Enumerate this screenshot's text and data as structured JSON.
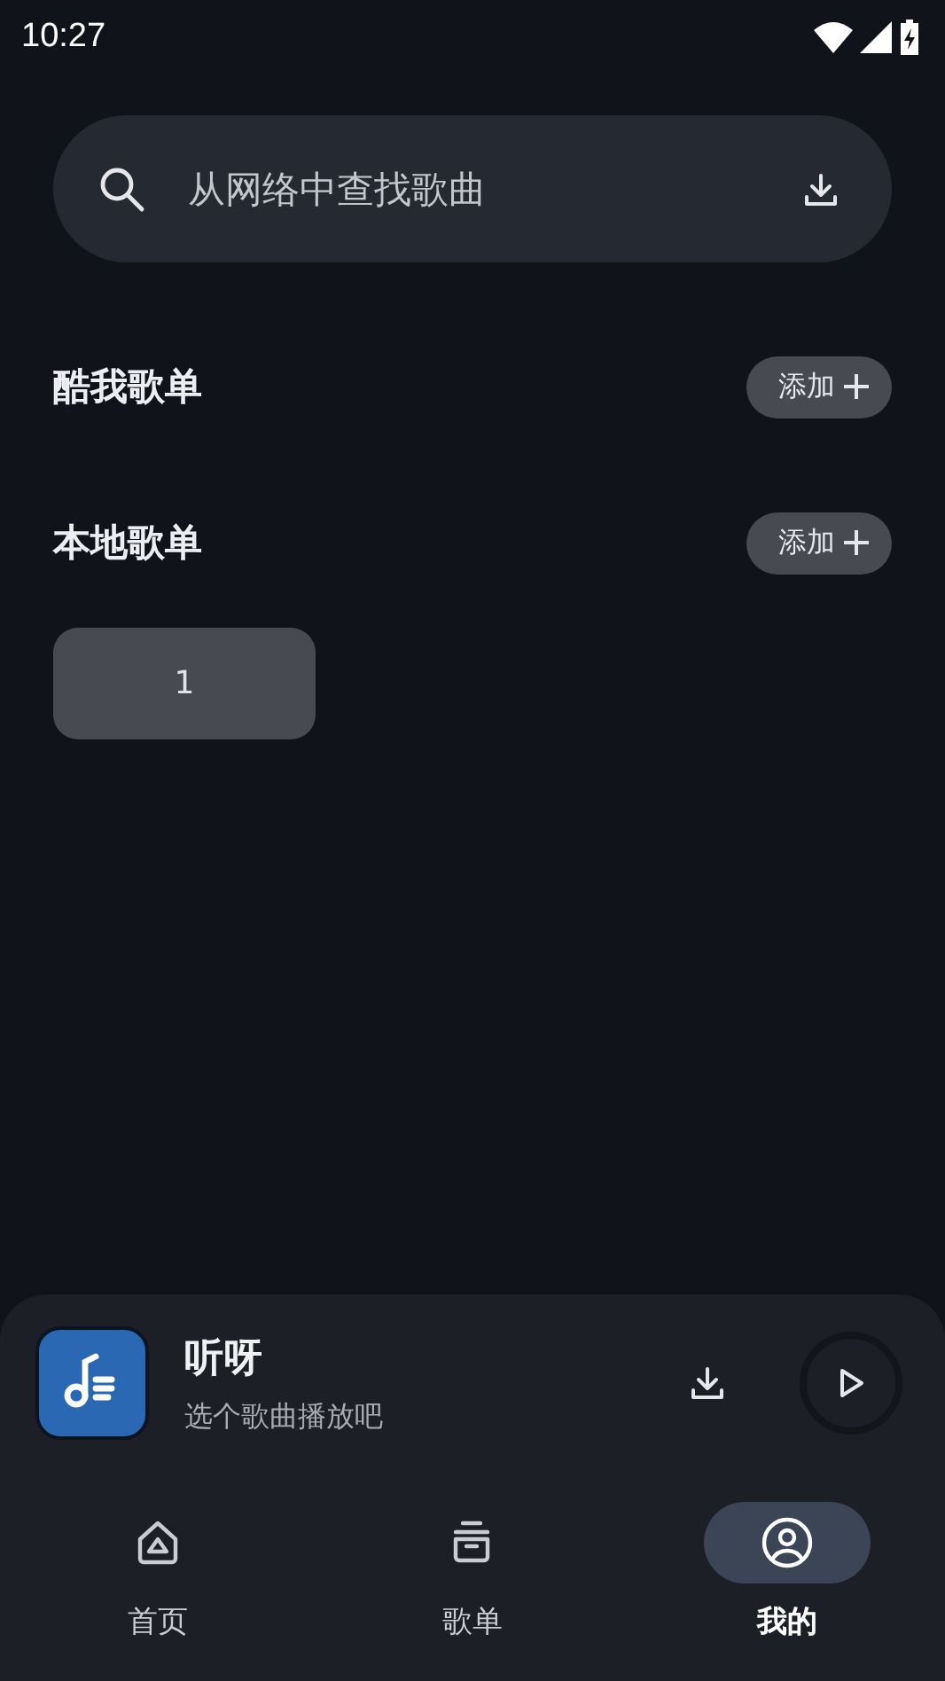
{
  "status_bar": {
    "time": "10:27"
  },
  "search": {
    "placeholder": "从网络中查找歌曲"
  },
  "sections": [
    {
      "title": "酷我歌单",
      "add_label": "添加"
    },
    {
      "title": "本地歌单",
      "add_label": "添加",
      "playlists": [
        {
          "name": "1"
        }
      ]
    }
  ],
  "player": {
    "title": "听呀",
    "subtitle": "选个歌曲播放吧"
  },
  "nav": [
    {
      "label": "首页",
      "kind": "home",
      "selected": false
    },
    {
      "label": "歌单",
      "kind": "list",
      "selected": false
    },
    {
      "label": "我的",
      "kind": "profile",
      "selected": true
    }
  ]
}
